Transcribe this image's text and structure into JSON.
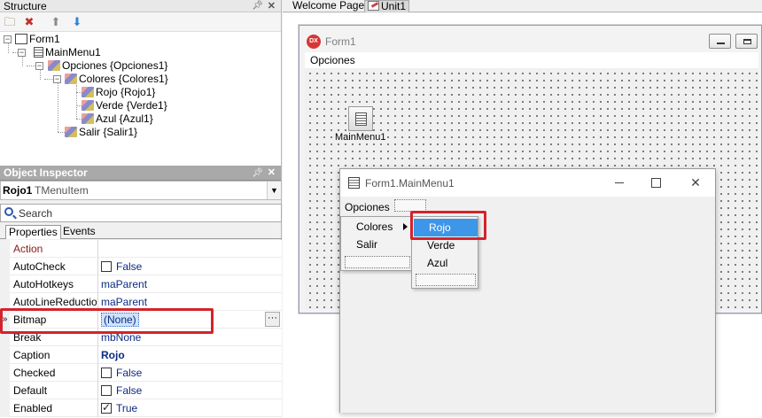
{
  "structure": {
    "title": "Structure",
    "tree": [
      {
        "label": "Form1"
      },
      {
        "label": "MainMenu1"
      },
      {
        "label": "Opciones {Opciones1}"
      },
      {
        "label": "Colores {Colores1}"
      },
      {
        "label": "Rojo {Rojo1}"
      },
      {
        "label": "Verde {Verde1}"
      },
      {
        "label": "Azul {Azul1}"
      },
      {
        "label": "Salir {Salir1}"
      }
    ]
  },
  "inspector": {
    "title": "Object Inspector",
    "object_name": "Rojo1",
    "object_class": "TMenuItem",
    "search_placeholder": "Search",
    "tabs": [
      "Properties",
      "Events"
    ],
    "properties": [
      {
        "name": "Action",
        "value": ""
      },
      {
        "name": "AutoCheck",
        "value": "False",
        "checkbox": false
      },
      {
        "name": "AutoHotkeys",
        "value": "maParent"
      },
      {
        "name": "AutoLineReduction",
        "value": "maParent"
      },
      {
        "name": "Bitmap",
        "value": "(None)"
      },
      {
        "name": "Break",
        "value": "mbNone"
      },
      {
        "name": "Caption",
        "value": "Rojo"
      },
      {
        "name": "Checked",
        "value": "False",
        "checkbox": false
      },
      {
        "name": "Default",
        "value": "False",
        "checkbox": false
      },
      {
        "name": "Enabled",
        "value": "True",
        "checkbox": true
      }
    ],
    "selected_marker": "»",
    "ellipsis": "···"
  },
  "editor": {
    "tabs": [
      "Welcome Page",
      "Unit1"
    ],
    "active_tab": "Unit1"
  },
  "form1": {
    "title": "Form1",
    "icon_text": "DX",
    "menu_item": "Opciones",
    "component_label": "MainMenu1"
  },
  "menu_designer": {
    "title": "Form1.MainMenu1",
    "bar_item": "Opciones",
    "submenu": [
      "Colores",
      "Salir"
    ],
    "colores_submenu": [
      "Rojo",
      "Verde",
      "Azul"
    ],
    "selected_item": "Rojo",
    "highlight_color": "#3d96e8"
  },
  "colors": {
    "highlight_box": "#d3232a",
    "category_text": "#8b1a1a",
    "value_text": "#0b2a82",
    "header_gray": "#a9a9a9"
  }
}
